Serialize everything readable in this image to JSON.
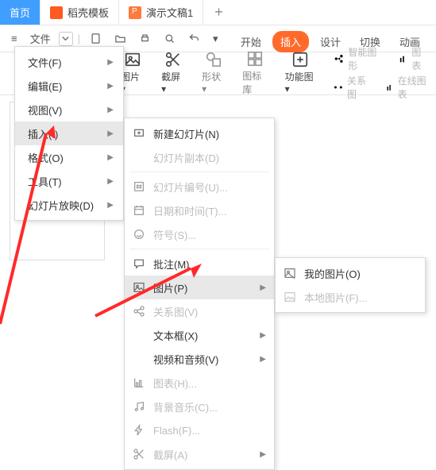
{
  "tabs": [
    {
      "label": "首页",
      "active": true,
      "ico": null
    },
    {
      "label": "稻壳模板",
      "active": false,
      "ico": "dk"
    },
    {
      "label": "演示文稿1",
      "active": false,
      "ico": "ppt"
    }
  ],
  "quick": {
    "hamburger": "≡",
    "file": "文件",
    "items": [
      "new",
      "open",
      "print",
      "preview",
      "undo",
      "redo"
    ]
  },
  "ribbonTabs": [
    {
      "label": "开始",
      "key": "home"
    },
    {
      "label": "插入",
      "key": "insert",
      "active": true
    },
    {
      "label": "设计",
      "key": "design"
    },
    {
      "label": "切换",
      "key": "trans"
    },
    {
      "label": "动画",
      "key": "anim"
    }
  ],
  "ribbon": {
    "btn1": {
      "label": "图片",
      "arrow": "▾"
    },
    "btn2": {
      "label": "截屏",
      "arrow": "▾"
    },
    "btn3": {
      "label": "形状",
      "arrow": "▾"
    },
    "btn4": {
      "label": "图标库"
    },
    "btn5": {
      "label": "功能图",
      "arrow": "▾"
    },
    "right": [
      {
        "l": "智能图形"
      },
      {
        "l": "图表"
      },
      {
        "l": "关系图"
      },
      {
        "l": "在线图表"
      }
    ]
  },
  "menu1": [
    {
      "label": "文件(F)",
      "sub": true
    },
    {
      "label": "编辑(E)",
      "sub": true
    },
    {
      "label": "视图(V)",
      "sub": true
    },
    {
      "label": "插入(I)",
      "sub": true,
      "sel": true
    },
    {
      "label": "格式(O)",
      "sub": true
    },
    {
      "label": "工具(T)",
      "sub": true
    },
    {
      "label": "幻灯片放映(D)",
      "sub": true
    }
  ],
  "menu2": [
    {
      "ico": "slide",
      "label": "新建幻灯片(N)"
    },
    {
      "ico": "none",
      "label": "幻灯片副本(D)",
      "dis": true
    },
    {
      "sep": true
    },
    {
      "ico": "num",
      "label": "幻灯片编号(U)...",
      "dis": true
    },
    {
      "ico": "date",
      "label": "日期和时间(T)...",
      "dis": true
    },
    {
      "ico": "sym",
      "label": "符号(S)...",
      "dis": true
    },
    {
      "sep": true
    },
    {
      "ico": "comment",
      "label": "批注(M)"
    },
    {
      "ico": "pic",
      "label": "图片(P)",
      "sub": true,
      "sel": true
    },
    {
      "ico": "rel",
      "label": "关系图(V)",
      "dis": true
    },
    {
      "ico": "none",
      "label": "文本框(X)",
      "sub": true
    },
    {
      "ico": "none",
      "label": "视频和音频(V)",
      "sub": true
    },
    {
      "ico": "chart",
      "label": "图表(H)...",
      "dis": true
    },
    {
      "ico": "music",
      "label": "背景音乐(C)...",
      "dis": true
    },
    {
      "ico": "flash",
      "label": "Flash(F)...",
      "dis": true
    },
    {
      "ico": "snip",
      "label": "截屏(A)",
      "sub": true,
      "dis": true
    }
  ],
  "menu3": [
    {
      "ico": "my",
      "label": "我的图片(O)"
    },
    {
      "ico": "local",
      "label": "本地图片(F)...",
      "dis": true
    }
  ]
}
